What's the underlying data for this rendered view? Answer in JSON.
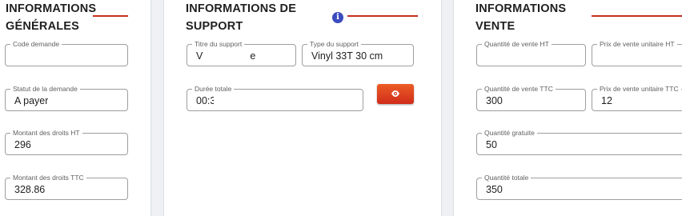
{
  "general": {
    "title_line1": "INFORMATIONS",
    "title_line2": "GÉNÉRALES",
    "fields": [
      {
        "label": "Code demande",
        "value": ""
      },
      {
        "label": "Statut de la demande",
        "value": "A payer"
      },
      {
        "label": "Montant des droits HT",
        "value": "296"
      },
      {
        "label": "Montant des droits TTC",
        "value": "328.86"
      }
    ]
  },
  "support": {
    "title_line1": "INFORMATIONS DE",
    "title_line2": "SUPPORT",
    "info_icon": "info-icon",
    "info_glyph": "i",
    "titre": {
      "label": "Titre du support",
      "value": "V                 e"
    },
    "type": {
      "label": "Type du support",
      "value": "Vinyl 33T 30 cm"
    },
    "duree": {
      "label": "Durée totale",
      "value": "00:3"
    },
    "view_button_icon": "eye-icon"
  },
  "vente": {
    "title_line1": "INFORMATIONS",
    "title_line2": "VENTE",
    "qte_ht": {
      "label": "Quantité de vente HT",
      "value": ""
    },
    "prix_ht": {
      "label": "Prix de vente unitaire HT",
      "value": ""
    },
    "qte_ttc": {
      "label": "Quantité de vente TTC",
      "value": "300"
    },
    "prix_ttc": {
      "label": "Prix de vente unitaire TTC",
      "value": "12"
    },
    "gratuite": {
      "label": "Quantité gratuite",
      "value": "50"
    },
    "totale": {
      "label": "Quantité totale",
      "value": "350"
    }
  },
  "colors": {
    "accent_red": "#c5311d",
    "button_orange": "#e24a22",
    "info_blue": "#3b4cbe"
  }
}
